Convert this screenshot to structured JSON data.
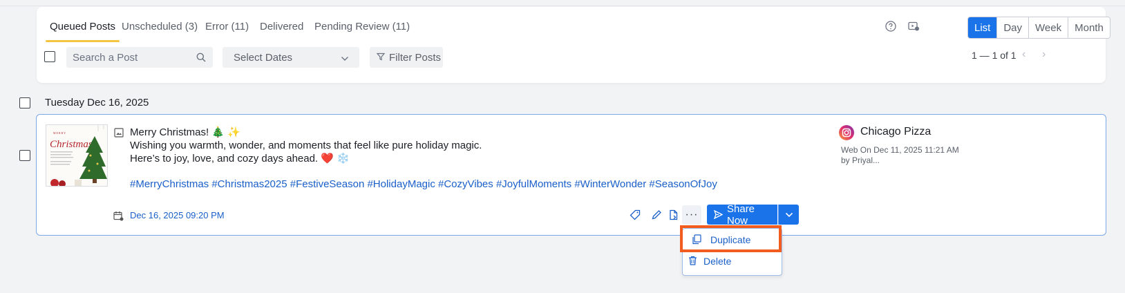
{
  "tabs": [
    {
      "label": "Queued Posts",
      "active": true
    },
    {
      "label": "Unscheduled (3)",
      "active": false
    },
    {
      "label": "Error (11)",
      "active": false
    },
    {
      "label": "Delivered",
      "active": false
    },
    {
      "label": "Pending Review (11)",
      "active": false
    }
  ],
  "view_options": [
    "List",
    "Day",
    "Week",
    "Month"
  ],
  "active_view": "List",
  "search": {
    "placeholder": "Search a Post",
    "value": ""
  },
  "date_select": {
    "label": "Select Dates"
  },
  "filter": {
    "label": "Filter Posts"
  },
  "pagination": {
    "text": "1 — 1 of 1"
  },
  "group": {
    "date_label": "Tuesday Dec 16, 2025"
  },
  "post": {
    "line1": "Merry Christmas! 🎄 ✨",
    "line2": "Wishing you warmth, wonder, and moments that feel like pure holiday magic.",
    "line3": "Here’s to joy, love, and cozy days ahead. ❤️ ❄️",
    "hashtags": "#MerryChristmas #Christmas2025 #FestiveSeason #HolidayMagic #CozyVibes #JoyfulMoments #WinterWonder #SeasonOfJoy",
    "scheduled": "Dec 16, 2025 09:20 PM",
    "thumbnail": {
      "title_small": "MERRY",
      "title_script": "Christmas"
    },
    "account": {
      "name": "Chicago Pizza",
      "meta_line1": "Web On Dec 11, 2025 11:21 AM",
      "meta_line2": "by Priyal..."
    },
    "share_label": "Share Now",
    "more_label": "···"
  },
  "menu": {
    "duplicate": "Duplicate",
    "delete": "Delete"
  },
  "colors": {
    "accent": "#1a73e8",
    "tab_underline": "#f4c542",
    "highlight": "#f25c1f",
    "link": "#1a5fc9"
  },
  "icons": [
    "help-icon",
    "video-settings-icon",
    "search-icon",
    "chevron-down-icon",
    "filter-icon",
    "image-icon",
    "calendar-icon",
    "tag-icon",
    "edit-icon",
    "document-icon",
    "more-icon",
    "send-icon",
    "instagram-icon",
    "copy-icon",
    "trash-icon"
  ]
}
